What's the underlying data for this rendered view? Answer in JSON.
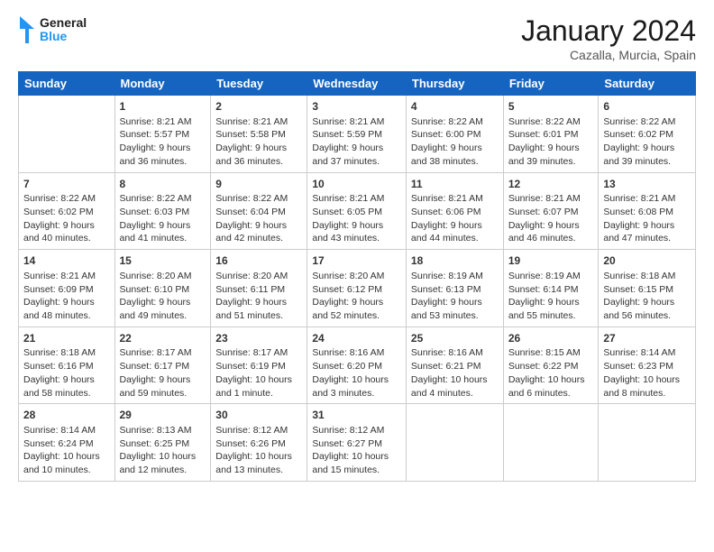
{
  "header": {
    "logo_general": "General",
    "logo_blue": "Blue",
    "month_year": "January 2024",
    "location": "Cazalla, Murcia, Spain"
  },
  "weekdays": [
    "Sunday",
    "Monday",
    "Tuesday",
    "Wednesday",
    "Thursday",
    "Friday",
    "Saturday"
  ],
  "weeks": [
    [
      {
        "day": "",
        "sunrise": "",
        "sunset": "",
        "daylight": ""
      },
      {
        "day": "1",
        "sunrise": "Sunrise: 8:21 AM",
        "sunset": "Sunset: 5:57 PM",
        "daylight": "Daylight: 9 hours and 36 minutes."
      },
      {
        "day": "2",
        "sunrise": "Sunrise: 8:21 AM",
        "sunset": "Sunset: 5:58 PM",
        "daylight": "Daylight: 9 hours and 36 minutes."
      },
      {
        "day": "3",
        "sunrise": "Sunrise: 8:21 AM",
        "sunset": "Sunset: 5:59 PM",
        "daylight": "Daylight: 9 hours and 37 minutes."
      },
      {
        "day": "4",
        "sunrise": "Sunrise: 8:22 AM",
        "sunset": "Sunset: 6:00 PM",
        "daylight": "Daylight: 9 hours and 38 minutes."
      },
      {
        "day": "5",
        "sunrise": "Sunrise: 8:22 AM",
        "sunset": "Sunset: 6:01 PM",
        "daylight": "Daylight: 9 hours and 39 minutes."
      },
      {
        "day": "6",
        "sunrise": "Sunrise: 8:22 AM",
        "sunset": "Sunset: 6:02 PM",
        "daylight": "Daylight: 9 hours and 39 minutes."
      }
    ],
    [
      {
        "day": "7",
        "sunrise": "Sunrise: 8:22 AM",
        "sunset": "Sunset: 6:02 PM",
        "daylight": "Daylight: 9 hours and 40 minutes."
      },
      {
        "day": "8",
        "sunrise": "Sunrise: 8:22 AM",
        "sunset": "Sunset: 6:03 PM",
        "daylight": "Daylight: 9 hours and 41 minutes."
      },
      {
        "day": "9",
        "sunrise": "Sunrise: 8:22 AM",
        "sunset": "Sunset: 6:04 PM",
        "daylight": "Daylight: 9 hours and 42 minutes."
      },
      {
        "day": "10",
        "sunrise": "Sunrise: 8:21 AM",
        "sunset": "Sunset: 6:05 PM",
        "daylight": "Daylight: 9 hours and 43 minutes."
      },
      {
        "day": "11",
        "sunrise": "Sunrise: 8:21 AM",
        "sunset": "Sunset: 6:06 PM",
        "daylight": "Daylight: 9 hours and 44 minutes."
      },
      {
        "day": "12",
        "sunrise": "Sunrise: 8:21 AM",
        "sunset": "Sunset: 6:07 PM",
        "daylight": "Daylight: 9 hours and 46 minutes."
      },
      {
        "day": "13",
        "sunrise": "Sunrise: 8:21 AM",
        "sunset": "Sunset: 6:08 PM",
        "daylight": "Daylight: 9 hours and 47 minutes."
      }
    ],
    [
      {
        "day": "14",
        "sunrise": "Sunrise: 8:21 AM",
        "sunset": "Sunset: 6:09 PM",
        "daylight": "Daylight: 9 hours and 48 minutes."
      },
      {
        "day": "15",
        "sunrise": "Sunrise: 8:20 AM",
        "sunset": "Sunset: 6:10 PM",
        "daylight": "Daylight: 9 hours and 49 minutes."
      },
      {
        "day": "16",
        "sunrise": "Sunrise: 8:20 AM",
        "sunset": "Sunset: 6:11 PM",
        "daylight": "Daylight: 9 hours and 51 minutes."
      },
      {
        "day": "17",
        "sunrise": "Sunrise: 8:20 AM",
        "sunset": "Sunset: 6:12 PM",
        "daylight": "Daylight: 9 hours and 52 minutes."
      },
      {
        "day": "18",
        "sunrise": "Sunrise: 8:19 AM",
        "sunset": "Sunset: 6:13 PM",
        "daylight": "Daylight: 9 hours and 53 minutes."
      },
      {
        "day": "19",
        "sunrise": "Sunrise: 8:19 AM",
        "sunset": "Sunset: 6:14 PM",
        "daylight": "Daylight: 9 hours and 55 minutes."
      },
      {
        "day": "20",
        "sunrise": "Sunrise: 8:18 AM",
        "sunset": "Sunset: 6:15 PM",
        "daylight": "Daylight: 9 hours and 56 minutes."
      }
    ],
    [
      {
        "day": "21",
        "sunrise": "Sunrise: 8:18 AM",
        "sunset": "Sunset: 6:16 PM",
        "daylight": "Daylight: 9 hours and 58 minutes."
      },
      {
        "day": "22",
        "sunrise": "Sunrise: 8:17 AM",
        "sunset": "Sunset: 6:17 PM",
        "daylight": "Daylight: 9 hours and 59 minutes."
      },
      {
        "day": "23",
        "sunrise": "Sunrise: 8:17 AM",
        "sunset": "Sunset: 6:19 PM",
        "daylight": "Daylight: 10 hours and 1 minute."
      },
      {
        "day": "24",
        "sunrise": "Sunrise: 8:16 AM",
        "sunset": "Sunset: 6:20 PM",
        "daylight": "Daylight: 10 hours and 3 minutes."
      },
      {
        "day": "25",
        "sunrise": "Sunrise: 8:16 AM",
        "sunset": "Sunset: 6:21 PM",
        "daylight": "Daylight: 10 hours and 4 minutes."
      },
      {
        "day": "26",
        "sunrise": "Sunrise: 8:15 AM",
        "sunset": "Sunset: 6:22 PM",
        "daylight": "Daylight: 10 hours and 6 minutes."
      },
      {
        "day": "27",
        "sunrise": "Sunrise: 8:14 AM",
        "sunset": "Sunset: 6:23 PM",
        "daylight": "Daylight: 10 hours and 8 minutes."
      }
    ],
    [
      {
        "day": "28",
        "sunrise": "Sunrise: 8:14 AM",
        "sunset": "Sunset: 6:24 PM",
        "daylight": "Daylight: 10 hours and 10 minutes."
      },
      {
        "day": "29",
        "sunrise": "Sunrise: 8:13 AM",
        "sunset": "Sunset: 6:25 PM",
        "daylight": "Daylight: 10 hours and 12 minutes."
      },
      {
        "day": "30",
        "sunrise": "Sunrise: 8:12 AM",
        "sunset": "Sunset: 6:26 PM",
        "daylight": "Daylight: 10 hours and 13 minutes."
      },
      {
        "day": "31",
        "sunrise": "Sunrise: 8:12 AM",
        "sunset": "Sunset: 6:27 PM",
        "daylight": "Daylight: 10 hours and 15 minutes."
      },
      {
        "day": "",
        "sunrise": "",
        "sunset": "",
        "daylight": ""
      },
      {
        "day": "",
        "sunrise": "",
        "sunset": "",
        "daylight": ""
      },
      {
        "day": "",
        "sunrise": "",
        "sunset": "",
        "daylight": ""
      }
    ]
  ]
}
